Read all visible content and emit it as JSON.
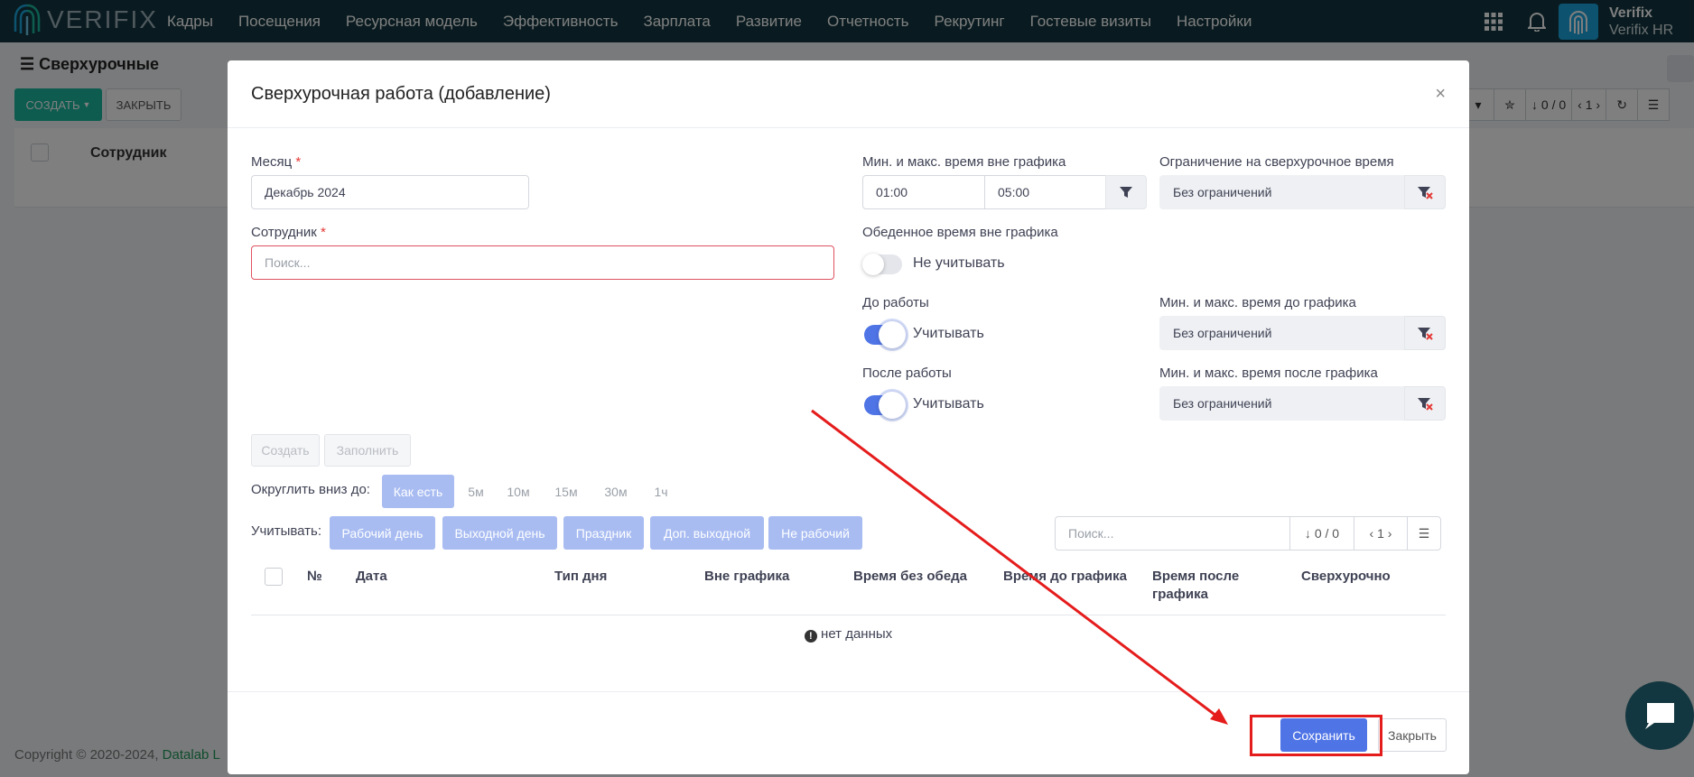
{
  "navbar": {
    "logo_text": "VERIFIX",
    "items": [
      "Кадры",
      "Посещения",
      "Ресурсная модель",
      "Эффективность",
      "Зарплата",
      "Развитие",
      "Отчетность",
      "Рекрутинг",
      "Гостевые визиты",
      "Настройки"
    ],
    "user_name": "Verifix",
    "user_company": "Verifix HR"
  },
  "page": {
    "title": "Сверхурочные",
    "create_label": "СОЗДАТЬ",
    "close_label": "ЗАКРЫТЬ",
    "column_employee": "Сотрудник",
    "pager_count": "0 / 0",
    "pager_page": "1",
    "copyright": "Copyright © 2020-2024,",
    "copyright_company": "Datalab L"
  },
  "modal": {
    "title": "Сверхурочная работа (добавление)",
    "month_label": "Месяц",
    "month_value": "Декабрь 2024",
    "employee_label": "Сотрудник",
    "employee_placeholder": "Поиск...",
    "minmax_label": "Мин. и макс. время вне графика",
    "min_value": "01:00",
    "max_value": "05:00",
    "limit_label": "Ограничение на сверхурочное время",
    "limit_value": "Без ограничений",
    "lunch_label": "Обеденное время вне графика",
    "lunch_toggle_text": "Не учитывать",
    "lunch_on": false,
    "before_label": "До работы",
    "before_toggle_text": "Учитывать",
    "before_on": true,
    "before_minmax_label": "Мин. и макс. время до графика",
    "before_minmax_value": "Без ограничений",
    "after_label": "После работы",
    "after_toggle_text": "Учитывать",
    "after_on": true,
    "after_minmax_label": "Мин. и макс. время после графика",
    "after_minmax_value": "Без ограничений",
    "btn_create": "Создать",
    "btn_fill": "Заполнить",
    "round_label": "Округлить вниз до:",
    "round_options": [
      "Как есть",
      "5м",
      "10м",
      "15м",
      "30м",
      "1ч"
    ],
    "round_selected": "Как есть",
    "consider_label": "Учитывать:",
    "consider_options": [
      "Рабочий день",
      "Выходной день",
      "Праздник",
      "Доп. выходной",
      "Не рабочий"
    ],
    "search_placeholder": "Поиск...",
    "pager_count": "0 / 0",
    "pager_page": "1",
    "columns": [
      "№",
      "Дата",
      "Тип дня",
      "Вне графика",
      "Время без обеда",
      "Время до графика",
      "Время после графика",
      "Сверхурочно"
    ],
    "empty_text": "нет данных",
    "save_label": "Сохранить",
    "close_label": "Закрыть"
  },
  "colors": {
    "navbar": "#133740",
    "primary": "#4f74e6",
    "create_button": "#1bb99f",
    "annotation": "#e51c1c"
  }
}
